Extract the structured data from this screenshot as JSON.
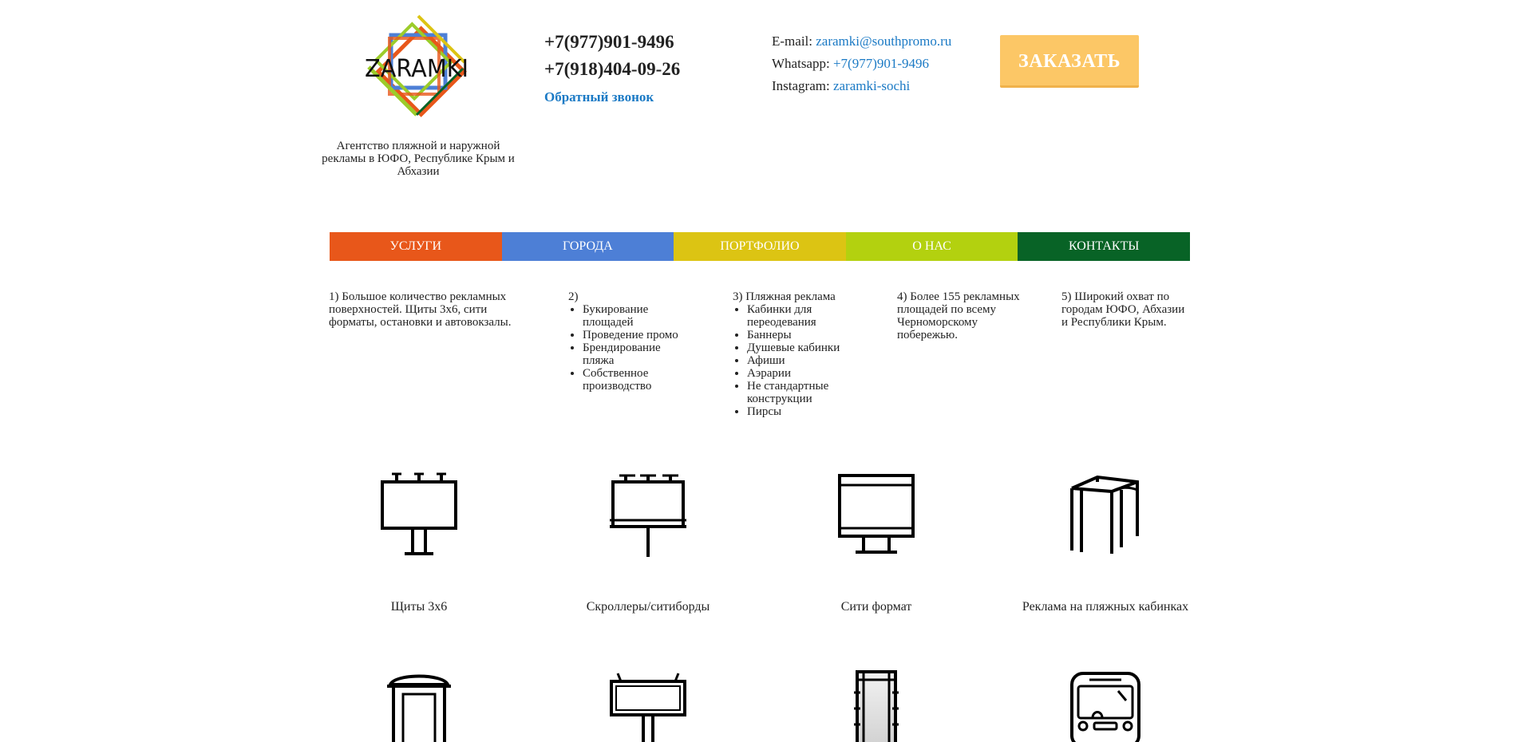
{
  "brand": {
    "logo_text": "ZARAMKI",
    "tagline": "Агентство пляжной и наружной рекламы в ЮФО, Республике Крым и Абхазии"
  },
  "phones": {
    "phone1": "+7(977)901-9496",
    "phone2": "+7(918)404-09-26",
    "callback": "Обратный звонок"
  },
  "contacts": {
    "email_label": "E-mail:",
    "email": "zaramki@southpromo.ru",
    "whatsapp_label": "Whatsapp:",
    "whatsapp": "+7(977)901-9496",
    "instagram_label": "Instagram:",
    "instagram": "zaramki-sochi"
  },
  "order_button": "ЗАКАЗАТЬ",
  "menu": [
    {
      "label": "УСЛУГИ",
      "color": "#e8571a"
    },
    {
      "label": "ГОРОДА",
      "color": "#4d7fd6"
    },
    {
      "label": "ПОРТФОЛИО",
      "color": "#dcc413"
    },
    {
      "label": "О НАС",
      "color": "#b3d10f"
    },
    {
      "label": "КОНТАКТЫ",
      "color": "#086326"
    }
  ],
  "features": {
    "f1": "1) Большое количество рекламных поверхностей. Щиты 3х6, сити форматы, остановки и автовокзалы.",
    "f2_title": "2)",
    "f2_items": [
      "Букирование площадей",
      "Проведение промо",
      "Брендирование пляжа",
      "Собственное производство"
    ],
    "f3_title": "3) Пляжная реклама",
    "f3_items": [
      "Кабинки для переодевания",
      "Баннеры",
      "Душевые кабинки",
      "Афиши",
      "Аэрарии",
      "Не стандартные конструкции",
      "Пирсы"
    ],
    "f4": "4) Более 155 рекламных площадей по всему Черноморскому побережью.",
    "f5": "5) Широкий охват по городам ЮФО, Абхазии и Республики Крым."
  },
  "services": [
    {
      "label": "Щиты 3х6",
      "icon": "billboard-icon"
    },
    {
      "label": "Скроллеры/ситиборды",
      "icon": "scroller-icon"
    },
    {
      "label": "Сити формат",
      "icon": "city-format-icon"
    },
    {
      "label": "Реклама на пляжных кабинках",
      "icon": "beach-cabin-icon"
    },
    {
      "label": "",
      "icon": "kiosk-icon"
    },
    {
      "label": "",
      "icon": "roadside-billboard-icon"
    },
    {
      "label": "",
      "icon": "pillar-icon"
    },
    {
      "label": "",
      "icon": "bus-icon"
    }
  ]
}
